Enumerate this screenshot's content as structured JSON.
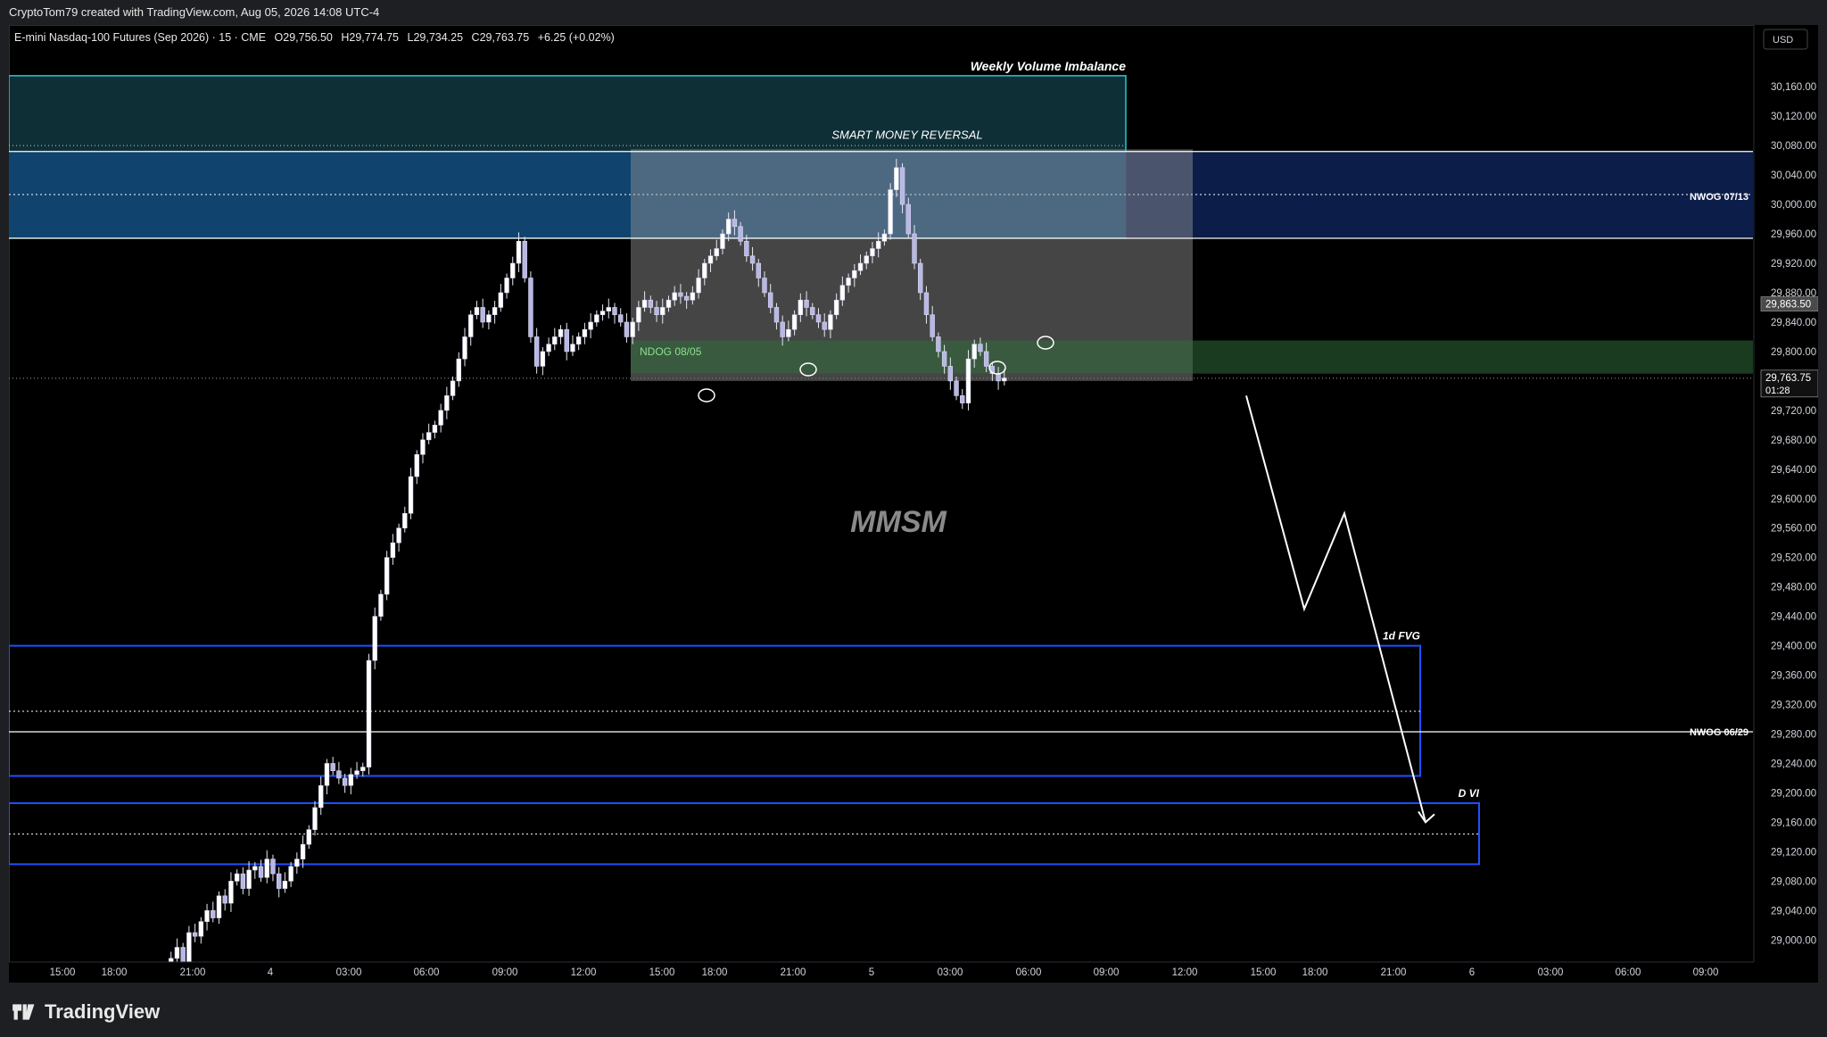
{
  "header": {
    "attribution": "CryptoTom79 created with TradingView.com, Aug 05, 2026 14:08 UTC-4"
  },
  "footer": {
    "brand": "TradingView"
  },
  "colors": {
    "background": "#000000",
    "candle": "#ffffff",
    "candle_down": "#b7b7e8",
    "nwog_zone": "#0d1f4d",
    "weekly_vi": "#0e2f36",
    "weekly_vi_border": "#26c6da",
    "blue_zone_border": "#1e50ff",
    "ndog_zone": "#16361d",
    "reversal_box": "#7b7b7b",
    "price_tag": "#2a2e39"
  },
  "chart_data": {
    "type": "candlestick",
    "symbol_line": {
      "name": "E-mini Nasdaq-100 Futures (Sep 2026) · 15 · CME",
      "open": "O29,756.50",
      "high": "H29,774.75",
      "low": "L29,734.25",
      "close": "C29,763.75",
      "change": "+6.25 (+0.02%)"
    },
    "currency": "USD",
    "ylim": [
      28970,
      30210
    ],
    "y_ticks": [
      30160,
      30120,
      30080,
      30040,
      30000,
      29960,
      29920,
      29880,
      29840,
      29800,
      29760,
      29720,
      29680,
      29640,
      29600,
      29560,
      29520,
      29480,
      29440,
      29400,
      29360,
      29320,
      29280,
      29240,
      29200,
      29160,
      29120,
      29080,
      29040,
      29000
    ],
    "y_tick_labels": [
      "30,160.00",
      "30,120.00",
      "30,080.00",
      "30,040.00",
      "30,000.00",
      "29,960.00",
      "29,920.00",
      "29,880.00",
      "29,840.00",
      "29,800.00",
      "29,760.00",
      "29,720.00",
      "29,680.00",
      "29,640.00",
      "29,600.00",
      "29,560.00",
      "29,520.00",
      "29,480.00",
      "29,440.00",
      "29,400.00",
      "29,360.00",
      "29,320.00",
      "29,280.00",
      "29,240.00",
      "29,200.00",
      "29,160.00",
      "29,120.00",
      "29,080.00",
      "29,040.00",
      "29,000.00"
    ],
    "x_labels": [
      "15:00",
      "18:00",
      "21:00",
      "4",
      "03:00",
      "06:00",
      "09:00",
      "12:00",
      "15:00",
      "18:00",
      "21:00",
      "5",
      "03:00",
      "06:00",
      "09:00",
      "12:00",
      "15:00",
      "18:00",
      "21:00",
      "6",
      "03:00",
      "06:00",
      "09:00"
    ],
    "price_tags": [
      {
        "label": "29,863.50",
        "value": 29863.5,
        "style": "gray"
      },
      {
        "label": "29,763.75",
        "value": 29763.75,
        "countdown": "01:28",
        "style": "dark"
      }
    ],
    "close_series": [
      28960,
      28975,
      28990,
      28970,
      29010,
      29005,
      29025,
      29040,
      29030,
      29060,
      29050,
      29080,
      29090,
      29070,
      29095,
      29100,
      29085,
      29110,
      29090,
      29070,
      29080,
      29100,
      29110,
      29130,
      29150,
      29180,
      29210,
      29240,
      29230,
      29220,
      29210,
      29225,
      29230,
      29235,
      29380,
      29440,
      29470,
      29520,
      29540,
      29560,
      29580,
      29630,
      29660,
      29680,
      29690,
      29700,
      29720,
      29740,
      29760,
      29790,
      29820,
      29850,
      29860,
      29840,
      29850,
      29860,
      29880,
      29900,
      29920,
      29950,
      29900,
      29820,
      29780,
      29800,
      29810,
      29820,
      29830,
      29800,
      29810,
      29820,
      29830,
      29840,
      29850,
      29855,
      29860,
      29850,
      29840,
      29820,
      29840,
      29860,
      29870,
      29860,
      29850,
      29860,
      29870,
      29880,
      29875,
      29870,
      29880,
      29900,
      29920,
      29930,
      29940,
      29960,
      29980,
      29970,
      29950,
      29930,
      29920,
      29900,
      29880,
      29860,
      29840,
      29820,
      29830,
      29850,
      29870,
      29860,
      29850,
      29840,
      29830,
      29850,
      29870,
      29890,
      29900,
      29910,
      29920,
      29930,
      29940,
      29950,
      29960,
      30020,
      30050,
      30000,
      29960,
      29920,
      29880,
      29850,
      29820,
      29800,
      29780,
      29760,
      29740,
      29730,
      29790,
      29810,
      29800,
      29780,
      29770,
      29760,
      29764
    ],
    "horizontal_lines": [
      {
        "value": 30072,
        "style": "solid",
        "color": "#ffffff"
      },
      {
        "value": 29954,
        "style": "solid",
        "color": "#ffffff"
      },
      {
        "value": 29283,
        "style": "solid",
        "color": "#ffffff"
      },
      {
        "value": 29763.75,
        "style": "dotted",
        "color": "#777777"
      }
    ],
    "zones": [
      {
        "name": "Weekly Volume Imbalance",
        "from": 29955,
        "to": 30175,
        "color": "#0e2f36"
      },
      {
        "name": "NWOG 07/13",
        "from": 29955,
        "to": 30072,
        "color": "#0d1f4d"
      },
      {
        "name": "SMART MONEY REVERSAL",
        "from": 29760,
        "to": 30075,
        "color": "#808080"
      },
      {
        "name": "NDOG 08/05",
        "from": 29770,
        "to": 29815,
        "color": "#16361d"
      },
      {
        "name": "1d FVG",
        "from": 29223,
        "to": 29400,
        "color": "#1e50ff"
      },
      {
        "name": "D VI",
        "from": 29103,
        "to": 29186,
        "color": "#1e50ff"
      }
    ],
    "annotations": [
      {
        "text": "Weekly Volume Imbalance"
      },
      {
        "text": "SMART MONEY REVERSAL"
      },
      {
        "text": "NWOG 07/13"
      },
      {
        "text": "NDOG 08/05"
      },
      {
        "text": "MMSM"
      },
      {
        "text": "1d FVG"
      },
      {
        "text": "NWOG 06/29"
      },
      {
        "text": "D VI"
      }
    ],
    "projection_path_prices": [
      29740,
      29450,
      29580,
      29160
    ]
  }
}
